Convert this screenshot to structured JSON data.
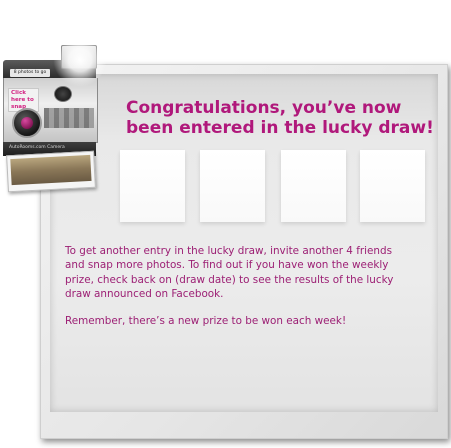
{
  "camera": {
    "badge": "8 photos to go",
    "sticker": "Click here to snap",
    "brand": "AutoRooms.com Camera"
  },
  "content": {
    "heading": "Congratulations, you’ve now been entered in the lucky draw!",
    "paragraph1": "To get another entry in the lucky draw, invite another 4 friends and snap more photos. To find out if you have won the weekly prize, check back on (draw date) to see the results of the lucky draw announced on Facebook.",
    "paragraph2": "Remember, there’s a new prize to be won each week!"
  },
  "colors": {
    "accent": "#b0187b",
    "body_text": "#9c1f74"
  }
}
